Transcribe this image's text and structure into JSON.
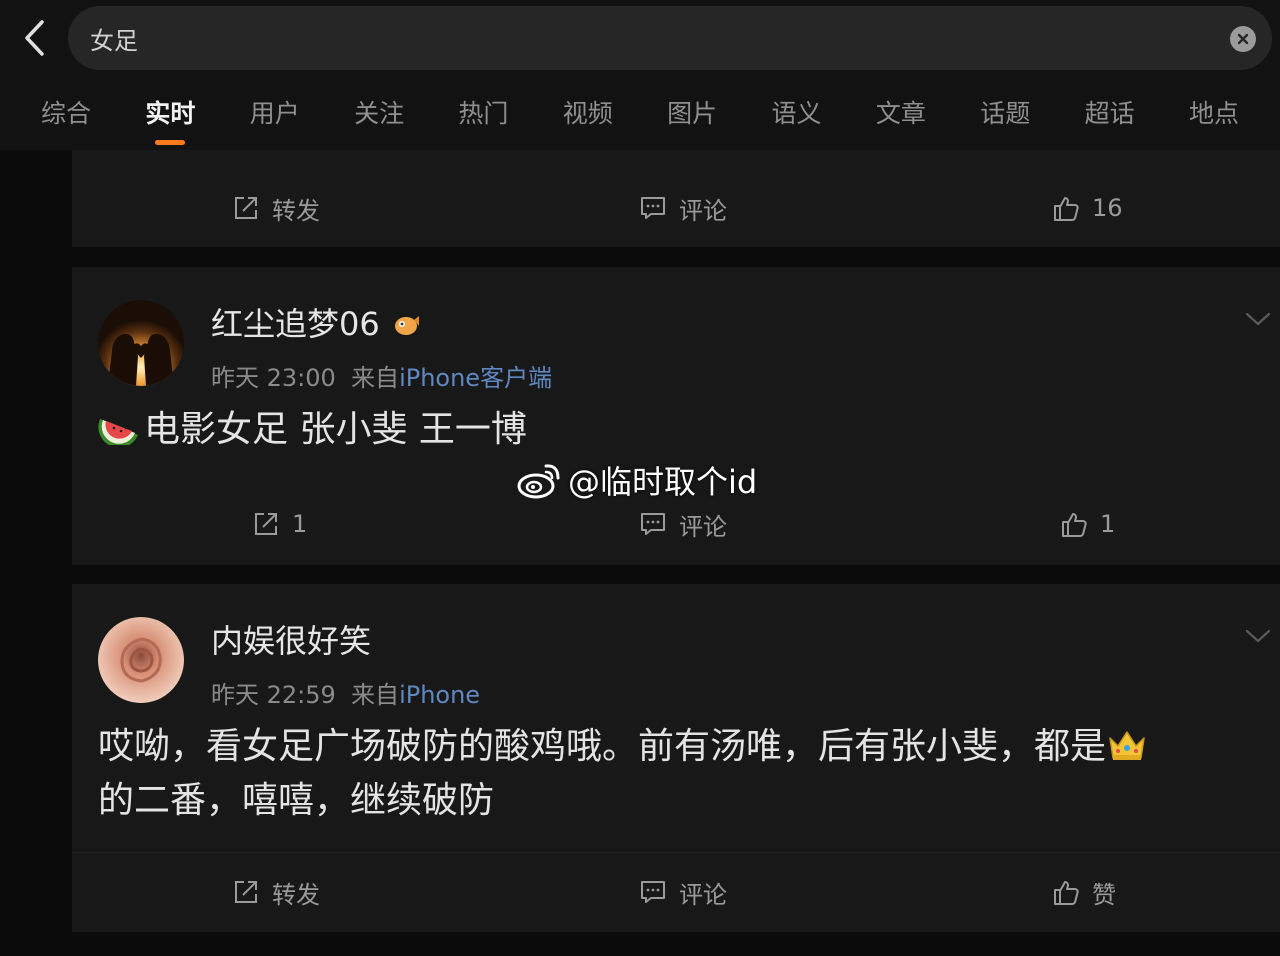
{
  "search": {
    "value": "女足"
  },
  "tabs": [
    {
      "label": "综合"
    },
    {
      "label": "实时"
    },
    {
      "label": "用户"
    },
    {
      "label": "关注"
    },
    {
      "label": "热门"
    },
    {
      "label": "视频"
    },
    {
      "label": "图片"
    },
    {
      "label": "语义"
    },
    {
      "label": "文章"
    },
    {
      "label": "话题"
    },
    {
      "label": "超话"
    },
    {
      "label": "地点"
    }
  ],
  "active_tab": "实时",
  "card0": {
    "repost": "转发",
    "comment": "评论",
    "like": "16"
  },
  "post1": {
    "username": "红尘追梦06",
    "time": "昨天 23:00",
    "from_label": "来自",
    "source": "iPhone客户端",
    "text": "电影女足 张小斐 王一博",
    "repost": "1",
    "comment": "评论",
    "like": "1"
  },
  "post2": {
    "username": "内娱很好笑",
    "time": "昨天 22:59",
    "from_label": "来自",
    "source": "iPhone",
    "text_line1": "哎呦，看女足广场破防的酸鸡哦。前有汤唯，后有张小斐，都是",
    "text_line2": "的二番，嘻嘻，继续破防",
    "repost": "转发",
    "comment": "评论",
    "like": "赞"
  },
  "watermark": {
    "text": "@临时取个id"
  },
  "colors": {
    "accent": "#ff7a1a",
    "link": "#5f87c2",
    "background": "#0b0b0b",
    "card": "#181818"
  }
}
